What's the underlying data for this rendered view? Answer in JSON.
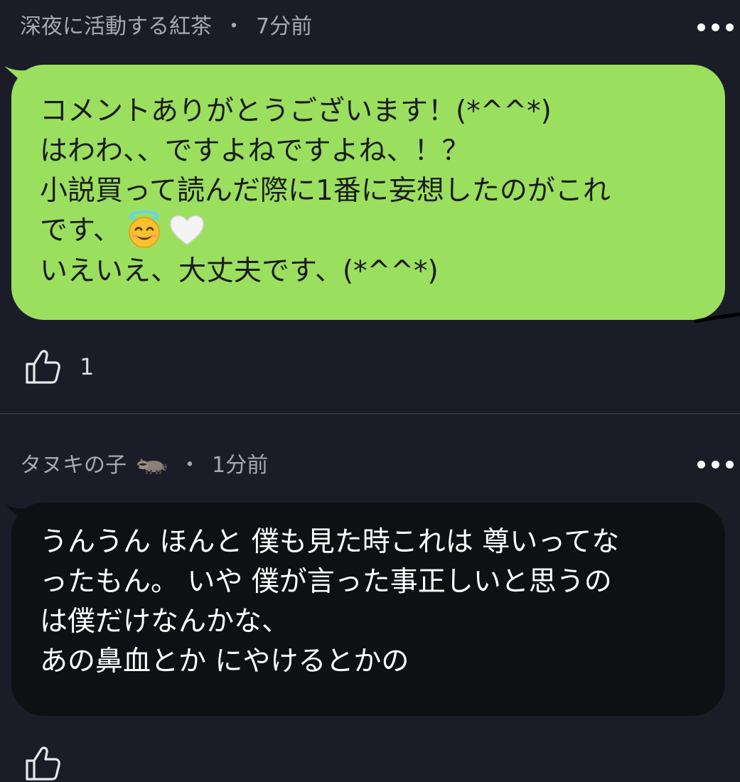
{
  "comments": [
    {
      "author": "深夜に活動する紅茶",
      "separator": "・",
      "time": "7分前",
      "lines": [
        "コメントありがとうございます！(*^^*)",
        "はわわ、、ですよねですよね、！？",
        "小説買って読んだ際に1番に妄想したのがこれ",
        "です、",
        "いえいえ、大丈夫です、(*^^*)"
      ],
      "emojis": [
        "smiling-face-with-halo",
        "white-heart"
      ],
      "like_count": "1",
      "bubble_color": "#9bdf5f"
    },
    {
      "author": "タヌキの子",
      "author_icon": "raccoon-icon",
      "separator": "・",
      "time": "1分前",
      "lines": [
        "うんうん ほんと 僕も見た時これは 尊いってな",
        "ったもん。 いや 僕が言った事正しいと思うの",
        "は僕だけなんかな、",
        "あの鼻血とか にやけるとかの"
      ],
      "bubble_color": "#0f1013"
    }
  ],
  "colors": {
    "background": "#1a1d28",
    "meta_text": "#a6a9b1"
  }
}
